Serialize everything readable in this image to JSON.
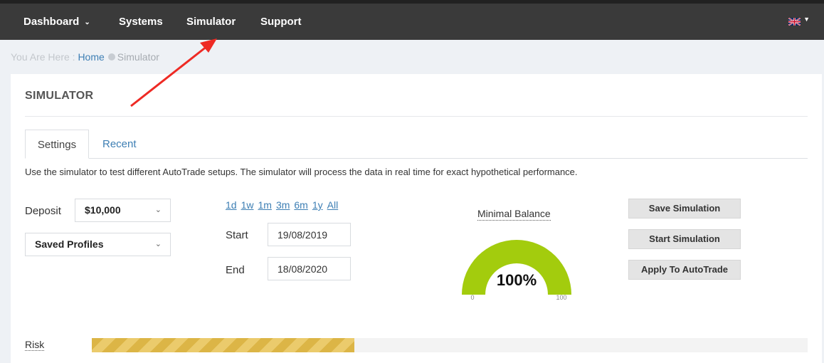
{
  "nav": {
    "items": [
      {
        "label": "Dashboard",
        "has_dropdown": true
      },
      {
        "label": "Systems"
      },
      {
        "label": "Simulator"
      },
      {
        "label": "Support"
      }
    ]
  },
  "breadcrumb": {
    "prefix": "You Are Here :",
    "home": "Home",
    "current": "Simulator"
  },
  "page": {
    "title": "SIMULATOR"
  },
  "tabs": [
    {
      "label": "Settings",
      "active": true
    },
    {
      "label": "Recent",
      "active": false
    }
  ],
  "description": "Use the simulator to test different AutoTrade setups. The simulator will process the data in real time for exact hypothetical performance.",
  "deposit": {
    "label": "Deposit",
    "value": "$10,000"
  },
  "profiles": {
    "value": "Saved Profiles"
  },
  "ranges": [
    "1d",
    "1w",
    "1m",
    "3m",
    "6m",
    "1y",
    "All"
  ],
  "dates": {
    "start_label": "Start",
    "start_value": "19/08/2019",
    "end_label": "End",
    "end_value": "18/08/2020"
  },
  "gauge": {
    "title": "Minimal Balance",
    "value_text": "100%",
    "value": 100,
    "min_label": "0",
    "max_label": "100",
    "fill_color": "#a3cc0d"
  },
  "buttons": {
    "save": "Save Simulation",
    "start": "Start Simulation",
    "apply": "Apply To AutoTrade"
  },
  "risk": {
    "label": "Risk",
    "level": 0.367
  },
  "colors": {
    "navbar": "#3a3a3a",
    "link": "#3e7fb4",
    "risk": "#dcb546",
    "annotation_arrow": "#ee2a24"
  }
}
